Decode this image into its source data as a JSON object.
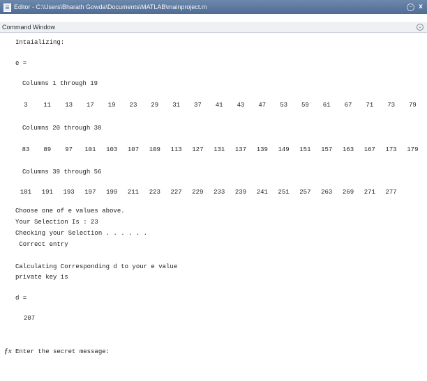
{
  "window": {
    "title": "Editor - C:\\Users\\Bharath Gowda\\Documents\\MATLAB\\mainproject.m",
    "controls": [
      "restore-icon",
      "close-icon"
    ]
  },
  "panel": {
    "title": "Command Window",
    "menu_icon": "panel-actions-icon"
  },
  "console": {
    "init": "Intaializing:",
    "e_var": "e =",
    "blocks": [
      {
        "header": "Columns 1 through 19",
        "values": [
          "3",
          "11",
          "13",
          "17",
          "19",
          "23",
          "29",
          "31",
          "37",
          "41",
          "43",
          "47",
          "53",
          "59",
          "61",
          "67",
          "71",
          "73",
          "79"
        ]
      },
      {
        "header": "Columns 20 through 38",
        "values": [
          "83",
          "89",
          "97",
          "101",
          "103",
          "107",
          "109",
          "113",
          "127",
          "131",
          "137",
          "139",
          "149",
          "151",
          "157",
          "163",
          "167",
          "173",
          "179"
        ]
      },
      {
        "header": "Columns 39 through 56",
        "values": [
          "181",
          "191",
          "193",
          "197",
          "199",
          "211",
          "223",
          "227",
          "229",
          "233",
          "239",
          "241",
          "251",
          "257",
          "263",
          "269",
          "271",
          "277"
        ]
      }
    ],
    "choose": "Choose one of e values above.",
    "selection": "Your Selection Is : 23",
    "checking": "Checking your Selection . . . . . .",
    "correct": " Correct entry",
    "calculating": "Calculating Corresponding d to your e value",
    "private_key": "private key is",
    "d_var": "d =",
    "d_value": "207",
    "prompt_icon": "fx-icon",
    "prompt": "Enter the secret message:"
  }
}
